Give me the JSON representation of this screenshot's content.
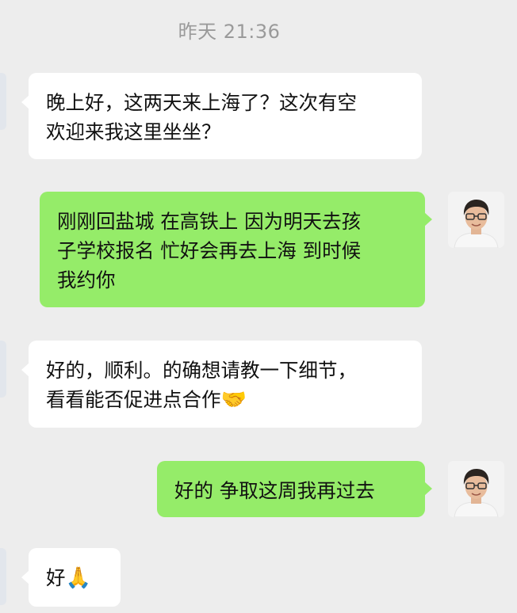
{
  "chat": {
    "timestamp": "昨天 21:36",
    "messages": [
      {
        "direction": "incoming",
        "lines": [
          "晚上好，这两天来上海了？这次有空",
          "欢迎来我这里坐坐？"
        ]
      },
      {
        "direction": "outgoing",
        "lines": [
          "刚刚回盐城 在高铁上 因为明天去孩",
          "子学校报名 忙好会再去上海 到时候",
          "我约你"
        ]
      },
      {
        "direction": "incoming",
        "lines": [
          "好的，顺利。的确想请教一下细节，",
          "看看能否促进点合作"
        ],
        "emoji": "🤝"
      },
      {
        "direction": "outgoing",
        "lines": [
          "好的 争取这周我再过去"
        ]
      },
      {
        "direction": "incoming",
        "lines": [
          "好"
        ],
        "emoji": "🙏"
      }
    ]
  },
  "avatars": {
    "self_icon": "user-avatar-photo"
  },
  "colors": {
    "background": "#ededed",
    "incoming_bubble": "#ffffff",
    "outgoing_bubble": "#95ec69",
    "timestamp_text": "#9a9a9a"
  }
}
